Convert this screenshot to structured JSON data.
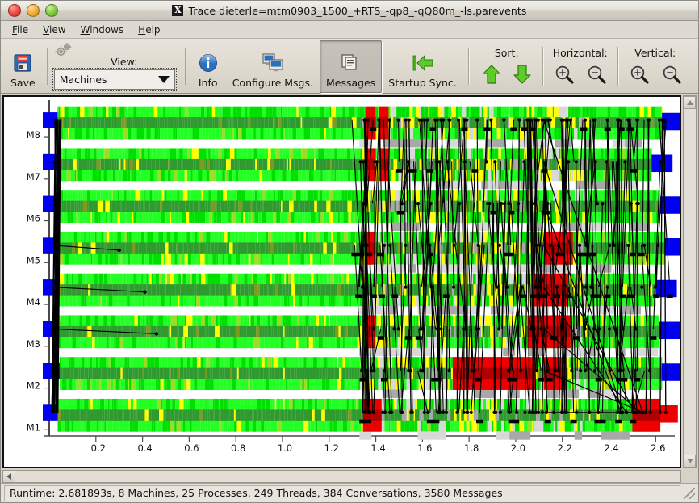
{
  "window": {
    "title": "Trace dieterle=mtm0903_1500_+RTS_-qp8_-qQ80m_-ls.parevents",
    "logo_glyph": "X",
    "buttons": [
      {
        "name": "close-button",
        "color": "#e8483c"
      },
      {
        "name": "minimize-button",
        "color": "#f0a733"
      },
      {
        "name": "maximize-button",
        "color": "#7dc63f"
      }
    ]
  },
  "menubar": {
    "items": [
      {
        "label": "File",
        "mnemonic": "F"
      },
      {
        "label": "View",
        "mnemonic": "V"
      },
      {
        "label": "Windows",
        "mnemonic": "W"
      },
      {
        "label": "Help",
        "mnemonic": "H"
      }
    ]
  },
  "toolbar": {
    "save_label": "Save",
    "view_label": "View:",
    "view_value": "Machines",
    "view_options": [
      "Machines"
    ],
    "info_label": "Info",
    "configure_label": "Configure Msgs.",
    "messages_label": "Messages",
    "messages_pressed": true,
    "startup_sync_label": "Startup Sync.",
    "sort_label": "Sort:",
    "horizontal_label": "Horizontal:",
    "vertical_label": "Vertical:"
  },
  "chart_data": {
    "type": "heatmap",
    "title": "",
    "xlabel": "",
    "ylabel": "",
    "xlim": [
      0.0,
      2.681893
    ],
    "ylim": [
      0,
      8
    ],
    "grid": false,
    "legend": "none",
    "x_ticks": [
      "0.2",
      "0.4",
      "0.6",
      "0.8",
      "1.0",
      "1.2",
      "1.4",
      "1.6",
      "1.8",
      "2.0",
      "2.2",
      "2.4",
      "2.6"
    ],
    "x_tick_values": [
      0.2,
      0.4,
      0.6,
      0.8,
      1.0,
      1.2,
      1.4,
      1.6,
      1.8,
      2.0,
      2.2,
      2.4,
      2.6
    ],
    "y_ticks": [
      "M8",
      "M7",
      "M6",
      "M5",
      "M4",
      "M3",
      "M2",
      "M1"
    ],
    "colors": {
      "running": "#00e000",
      "running_bright": "#22ff22",
      "running_dark": "#2f9b2f",
      "gc": "#ee0000",
      "idle": "#ffff00",
      "blocked": "#a8a8a8",
      "blocked_light": "#d8d8d8",
      "startup": "#0000ee",
      "message": "#000000"
    },
    "series": [
      {
        "name": "M8",
        "row": 0
      },
      {
        "name": "M7",
        "row": 1
      },
      {
        "name": "M6",
        "row": 2
      },
      {
        "name": "M5",
        "row": 3
      },
      {
        "name": "M4",
        "row": 4
      },
      {
        "name": "M3",
        "row": 5
      },
      {
        "name": "M2",
        "row": 6
      },
      {
        "name": "M1",
        "row": 7
      }
    ]
  },
  "statusbar": {
    "text": "Runtime: 2.681893s, 8 Machines, 25 Processes, 249 Threads, 384 Conversations, 3580 Messages",
    "runtime": "2.681893s",
    "machines": "8",
    "processes": "25",
    "threads": "249",
    "conversations": "384",
    "messages": "3580"
  }
}
